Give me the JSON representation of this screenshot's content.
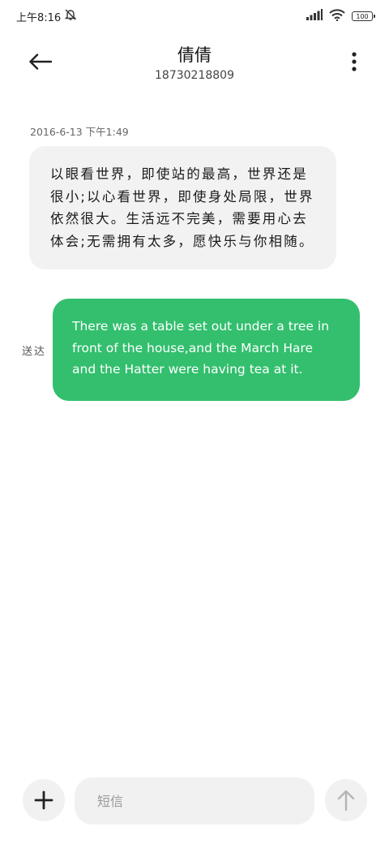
{
  "status_bar": {
    "time": "上午8:16",
    "battery": "100"
  },
  "header": {
    "contact_name": "倩倩",
    "contact_number": "18730218809"
  },
  "conversation": {
    "timestamp": "2016-6-13 下午1:49",
    "incoming_message": "以眼看世界，即使站的最高，世界还是很小;以心看世界，即使身处局限，世界依然很大。生活远不完美，需要用心去体会;无需拥有太多，愿快乐与你相随。",
    "outgoing_message": "There was a table set out under a tree in front of the house,and the March Hare and the Hatter were having tea at it.",
    "delivery_status": "送达"
  },
  "composer": {
    "placeholder": "短信"
  },
  "colors": {
    "outgoing_bubble": "#33bf6e",
    "incoming_bubble": "#f2f2f2",
    "button_bg": "#f1f1f1"
  }
}
